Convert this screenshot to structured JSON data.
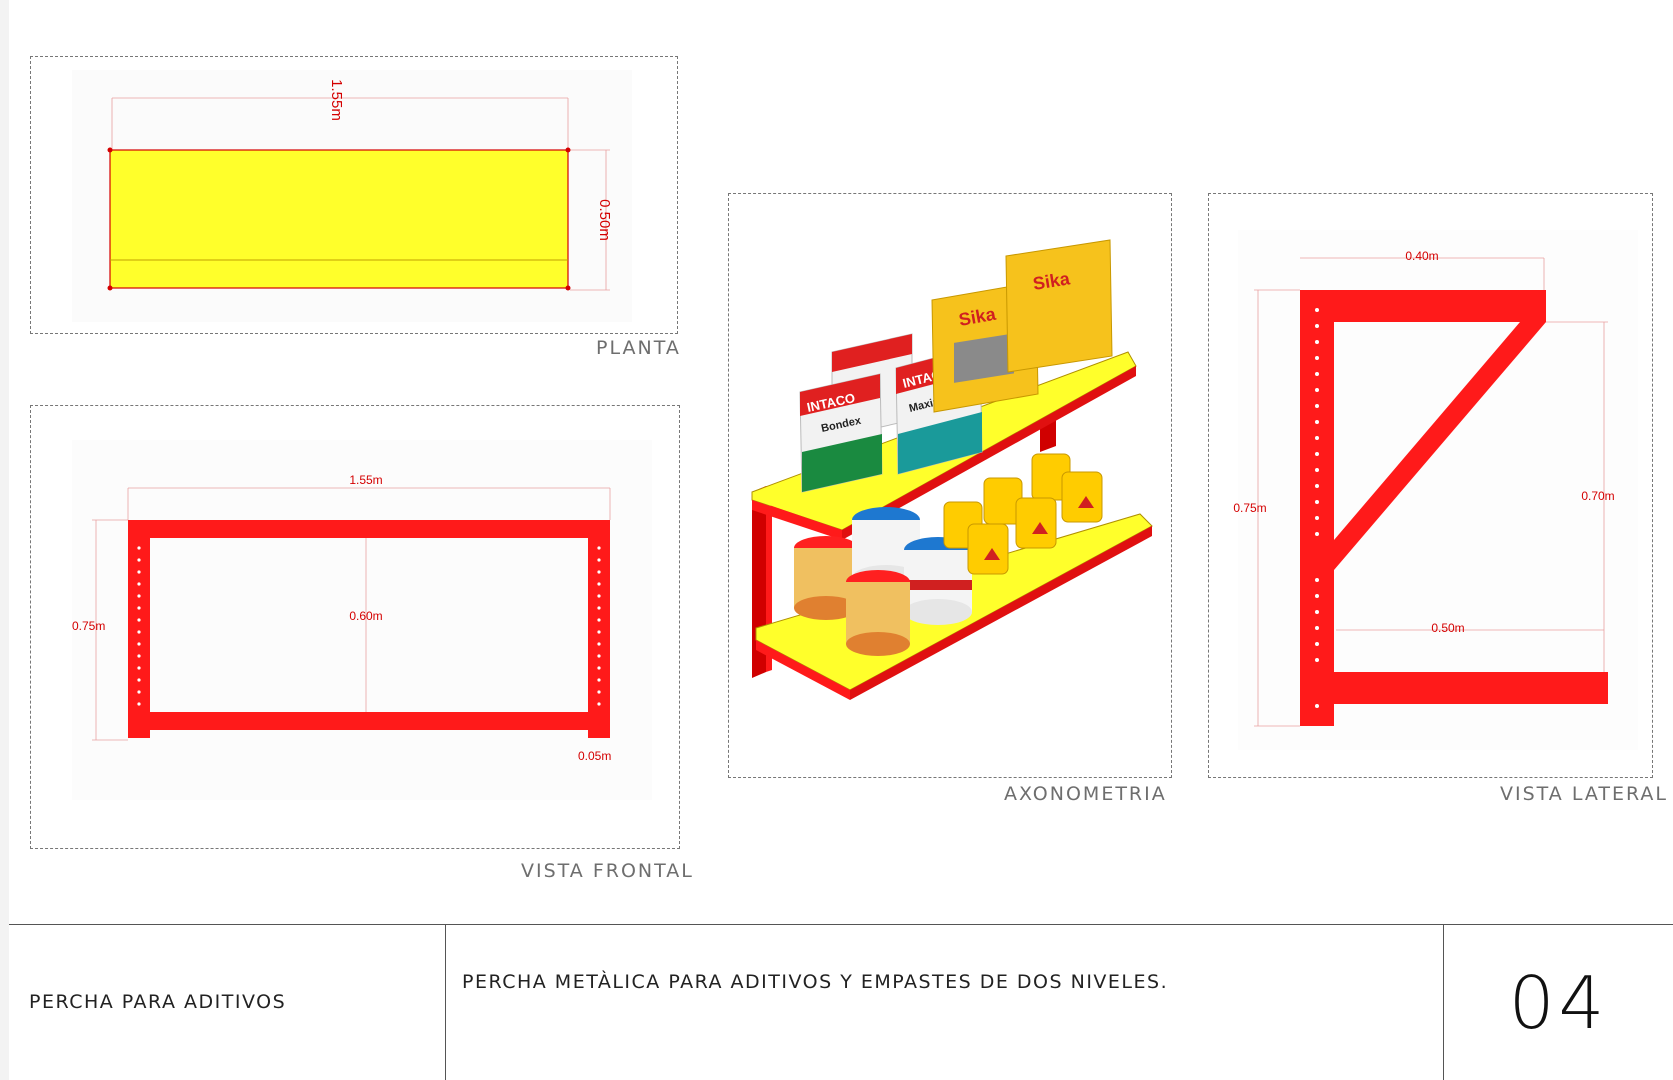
{
  "views": {
    "planta": {
      "caption": "PLANTA",
      "dim_width": "1.55m",
      "dim_depth": "0.50m"
    },
    "frontal": {
      "caption": "VISTA FRONTAL",
      "dim_width": "1.55m",
      "dim_height": "0.75m",
      "dim_gap": "0.60m",
      "dim_post": "0.05m"
    },
    "axonometria": {
      "caption": "AXONOMETRIA",
      "product_labels": [
        "INTACO",
        "Bondex",
        "INTACO",
        "Maximix",
        "Sika",
        "Sika"
      ]
    },
    "lateral": {
      "caption": "VISTA LATERAL",
      "dim_top": "0.40m",
      "dim_height": "0.75m",
      "dim_right": "0.70m",
      "dim_bottom": "0.50m"
    }
  },
  "title_block": {
    "name": "PERCHA PARA ADITIVOS",
    "description": "PERCHA METÀLICA PARA ADITIVOS Y EMPASTES DE DOS NIVELES.",
    "sheet_number": "04"
  },
  "colors": {
    "frame_red": "#ff1a1a",
    "shelf_yellow": "#ffff2b",
    "dim_red": "#d40000"
  }
}
